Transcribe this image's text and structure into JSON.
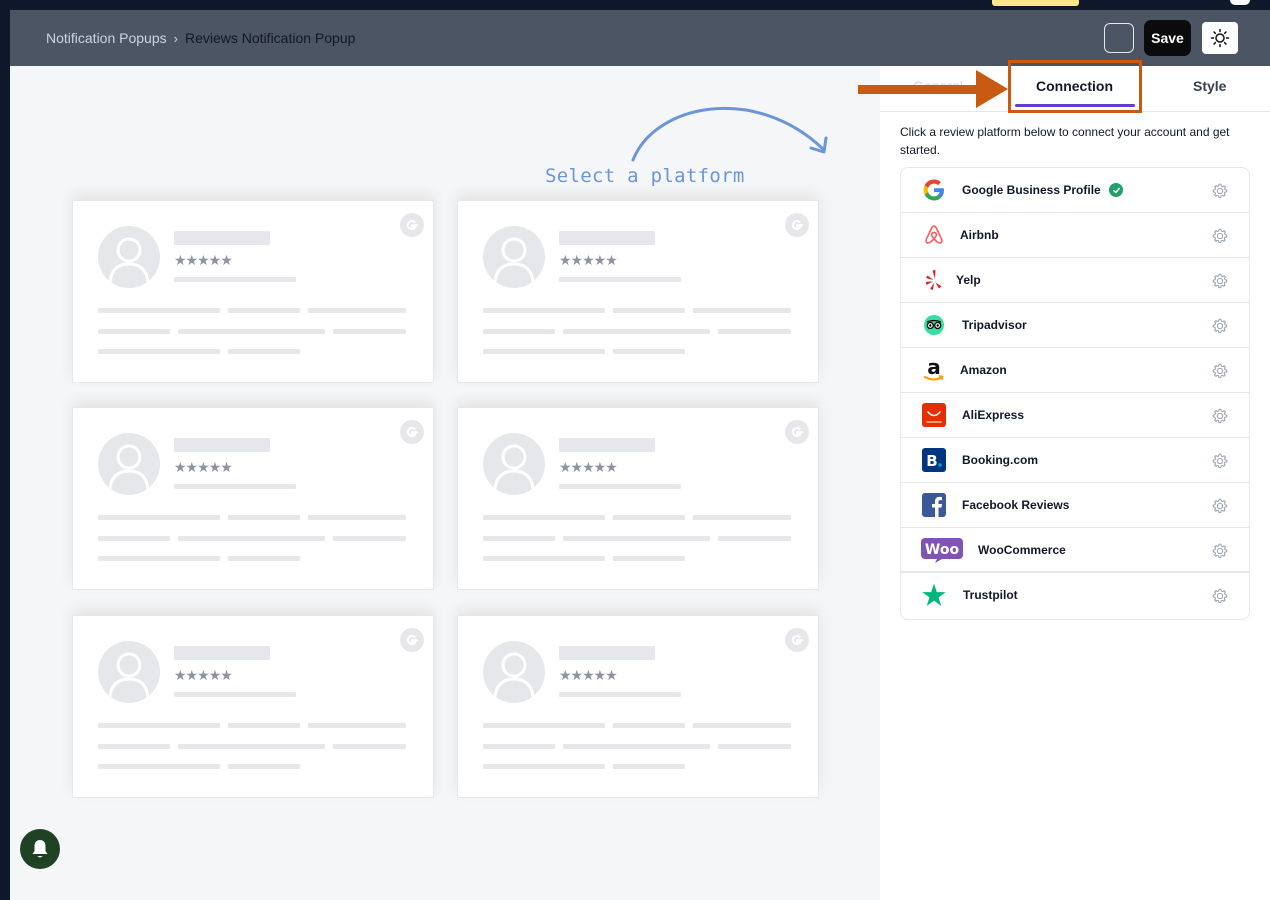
{
  "header": {
    "breadcrumb_parent": "Notification Popups",
    "breadcrumb_separator": "›",
    "breadcrumb_current": "Reviews Notification Popup",
    "save_label": "Save"
  },
  "canvas": {
    "annotation": "Select a platform",
    "card_count": 6,
    "card_stars": "★★★★★"
  },
  "panel": {
    "tabs": [
      {
        "label": "General",
        "active": false
      },
      {
        "label": "Connection",
        "active": true
      },
      {
        "label": "Style",
        "active": false
      }
    ],
    "description": "Click a review platform below to connect your account and get started.",
    "platforms": [
      {
        "name": "Google Business Profile",
        "connected": true,
        "icon": "google-icon"
      },
      {
        "name": "Airbnb",
        "connected": false,
        "icon": "airbnb-icon"
      },
      {
        "name": "Yelp",
        "connected": false,
        "icon": "yelp-icon"
      },
      {
        "name": "Tripadvisor",
        "connected": false,
        "icon": "tripadvisor-icon"
      },
      {
        "name": "Amazon",
        "connected": false,
        "icon": "amazon-icon"
      },
      {
        "name": "AliExpress",
        "connected": false,
        "icon": "aliexpress-icon"
      },
      {
        "name": "Booking.com",
        "connected": false,
        "icon": "booking-icon"
      },
      {
        "name": "Facebook Reviews",
        "connected": false,
        "icon": "facebook-icon"
      },
      {
        "name": "WooCommerce",
        "connected": false,
        "icon": "woocommerce-icon"
      },
      {
        "name": "Trustpilot",
        "connected": false,
        "icon": "trustpilot-icon"
      }
    ]
  },
  "colors": {
    "header_bg": "#4b5563",
    "tab_accent": "#5b3fd6",
    "highlight_orange": "#c85a12",
    "annotation_blue": "#6b95db",
    "connected_green": "#22a06b"
  }
}
